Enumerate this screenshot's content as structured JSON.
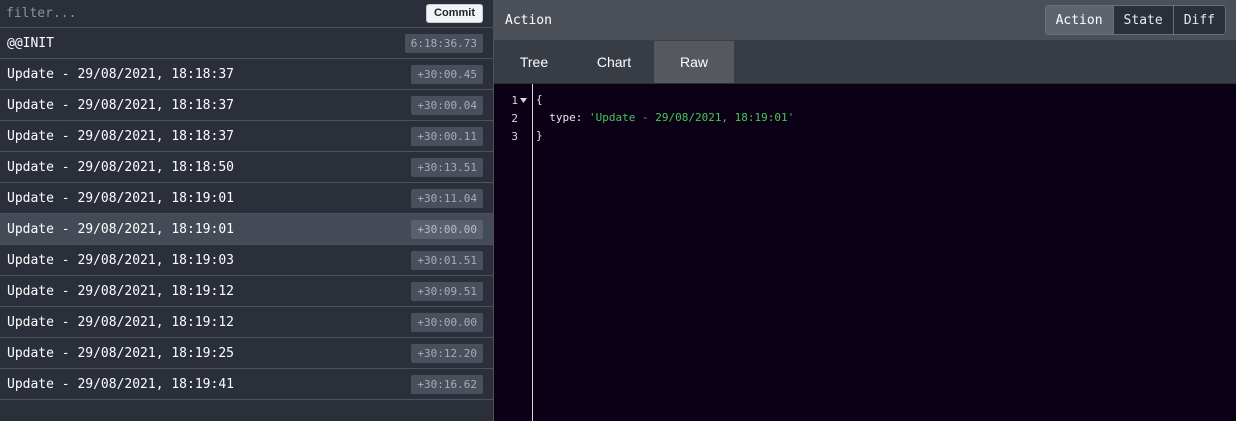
{
  "filter": {
    "placeholder": "filter...",
    "commit_label": "Commit"
  },
  "actions": [
    {
      "name": "@@INIT",
      "time": "6:18:36.73"
    },
    {
      "name": "Update - 29/08/2021, 18:18:37",
      "time": "+30:00.45"
    },
    {
      "name": "Update - 29/08/2021, 18:18:37",
      "time": "+30:00.04"
    },
    {
      "name": "Update - 29/08/2021, 18:18:37",
      "time": "+30:00.11"
    },
    {
      "name": "Update - 29/08/2021, 18:18:50",
      "time": "+30:13.51"
    },
    {
      "name": "Update - 29/08/2021, 18:19:01",
      "time": "+30:11.04"
    },
    {
      "name": "Update - 29/08/2021, 18:19:01",
      "time": "+30:00.00"
    },
    {
      "name": "Update - 29/08/2021, 18:19:03",
      "time": "+30:01.51"
    },
    {
      "name": "Update - 29/08/2021, 18:19:12",
      "time": "+30:09.51"
    },
    {
      "name": "Update - 29/08/2021, 18:19:12",
      "time": "+30:00.00"
    },
    {
      "name": "Update - 29/08/2021, 18:19:25",
      "time": "+30:12.20"
    },
    {
      "name": "Update - 29/08/2021, 18:19:41",
      "time": "+30:16.62"
    }
  ],
  "selected_action_index": 6,
  "inspector": {
    "title": "Action",
    "modes": [
      "Action",
      "State",
      "Diff"
    ],
    "active_mode": "Action",
    "tabs": [
      "Tree",
      "Chart",
      "Raw"
    ],
    "active_tab": "Raw"
  },
  "editor": {
    "line_numbers": [
      "1",
      "2",
      "3"
    ],
    "lines": {
      "open_brace": "{",
      "type_key": "  type: ",
      "type_value": "'Update - 29/08/2021, 18:19:01'",
      "close_brace": "}"
    }
  },
  "colors": {
    "list_background": "#2a2f3a",
    "selected_row": "#454b56",
    "editor_background": "#0b0016",
    "string_color": "#45c65a"
  }
}
